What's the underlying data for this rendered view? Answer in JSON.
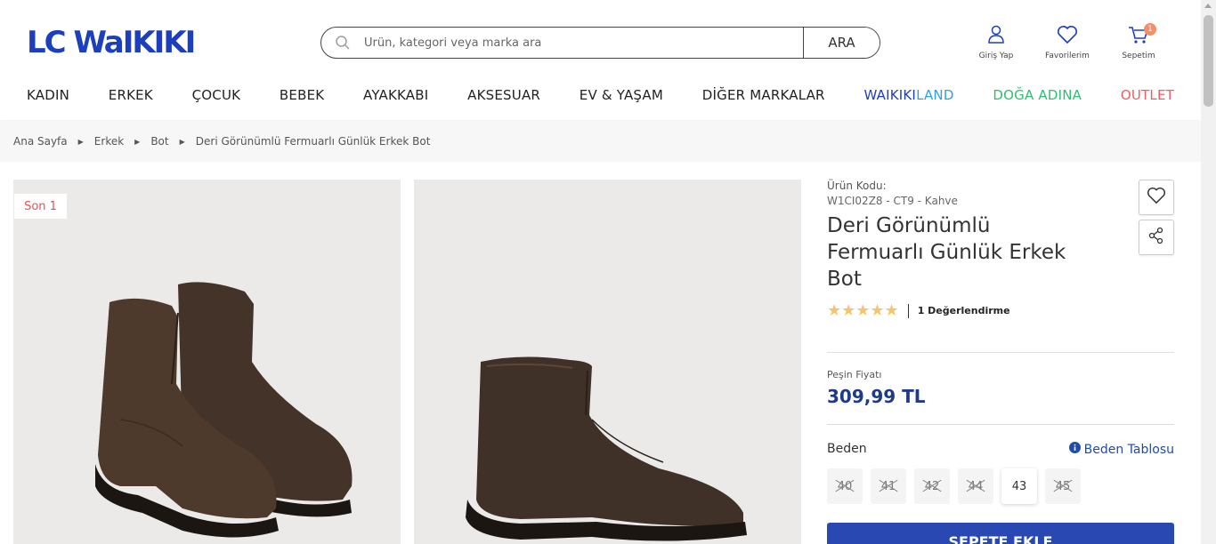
{
  "header": {
    "logo_text": "LC WaIKIKI",
    "search_placeholder": "Ürün, kategori veya marka ara",
    "search_button": "ARA",
    "login_label": "Giriş Yap",
    "favorites_label": "Favorilerim",
    "cart_label": "Sepetim",
    "cart_count": "1"
  },
  "nav": {
    "items": [
      {
        "label": "KADIN",
        "color": "#222222"
      },
      {
        "label": "ERKEK",
        "color": "#222222"
      },
      {
        "label": "ÇOCUK",
        "color": "#222222"
      },
      {
        "label": "BEBEK",
        "color": "#222222"
      },
      {
        "label": "AYAKKABI",
        "color": "#222222"
      },
      {
        "label": "AKSESUAR",
        "color": "#222222"
      },
      {
        "label": "EV & YAŞAM",
        "color": "#222222"
      },
      {
        "label": "DİĞER MARKALAR",
        "color": "#222222"
      },
      {
        "label": "WAIKIKILAND",
        "color": "#2b59c3"
      },
      {
        "label": "DOĞA ADINA",
        "color": "#2fbf71"
      },
      {
        "label": "OUTLET",
        "color": "#f15b5b"
      }
    ]
  },
  "breadcrumb": {
    "items": [
      "Ana Sayfa",
      "Erkek",
      "Bot"
    ],
    "current": "Deri Görünümlü Fermuarlı Günlük Erkek Bot"
  },
  "gallery": {
    "badge": "Son 1"
  },
  "product": {
    "code_label": "Ürün Kodu:",
    "code_value": "W1CI02Z8 - CT9 - Kahve",
    "title": "Deri Görünümlü Fermuarlı Günlük Erkek Bot",
    "stars": "★★★★★",
    "reviews": "1 Değerlendirme",
    "price_label": "Peşin Fiyatı",
    "price": "309,99 TL",
    "size_label": "Beden",
    "size_table_label": "Beden Tablosu",
    "sizes": [
      {
        "label": "40",
        "available": false
      },
      {
        "label": "41",
        "available": false
      },
      {
        "label": "42",
        "available": false
      },
      {
        "label": "44",
        "available": false
      },
      {
        "label": "43",
        "available": true
      },
      {
        "label": "45",
        "available": false
      }
    ],
    "add_to_cart": "SEPETE EKLE"
  },
  "colors": {
    "brand": "#1e3fbd",
    "price": "#1e3a8a",
    "button": "#2948b2",
    "star": "#f4c56a"
  }
}
